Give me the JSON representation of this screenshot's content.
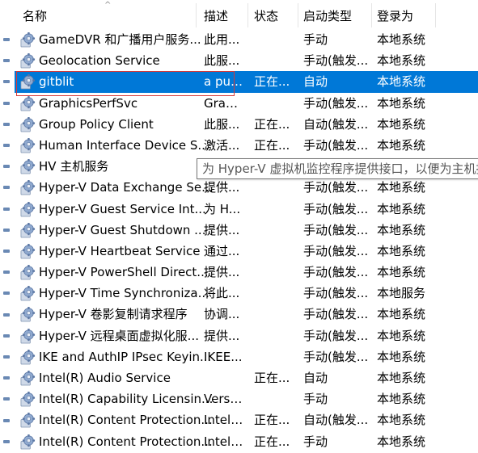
{
  "header": {
    "name": "名称",
    "description": "描述",
    "status": "状态",
    "startup_type": "启动类型",
    "logon_as": "登录为"
  },
  "colors": {
    "selection": "#0078d7",
    "highlight_border": "#d43a3a",
    "icon_gear": "#7a9cc6"
  },
  "tooltip": "为 Hyper-V 虚拟机监控程序提供接口，以便为主机提",
  "rows": [
    {
      "name": "GameDVR 和广播用户服务...",
      "desc": "此用...",
      "status": "",
      "start": "手动",
      "logon": "本地系统"
    },
    {
      "name": "Geolocation Service",
      "desc": "此服...",
      "status": "",
      "start": "手动(触发...",
      "logon": "本地系统"
    },
    {
      "name": "gitblit",
      "desc": "a pur...",
      "status": "正在...",
      "start": "自动",
      "logon": "本地系统"
    },
    {
      "name": "GraphicsPerfSvc",
      "desc": "Grap...",
      "status": "",
      "start": "手动(触发...",
      "logon": "本地系统"
    },
    {
      "name": "Group Policy Client",
      "desc": "此服...",
      "status": "正在...",
      "start": "自动(触发...",
      "logon": "本地系统"
    },
    {
      "name": "Human Interface Device S...",
      "desc": "激活...",
      "status": "正在...",
      "start": "手动(触发...",
      "logon": "本地系统"
    },
    {
      "name": "HV 主机服务",
      "desc": "",
      "status": "",
      "start": "",
      "logon": ""
    },
    {
      "name": "Hyper-V Data Exchange Se...",
      "desc": "提供...",
      "status": "",
      "start": "手动(触发...",
      "logon": "本地系统"
    },
    {
      "name": "Hyper-V Guest Service Int...",
      "desc": "为 H...",
      "status": "",
      "start": "手动(触发...",
      "logon": "本地系统"
    },
    {
      "name": "Hyper-V Guest Shutdown ...",
      "desc": "提供...",
      "status": "",
      "start": "手动(触发...",
      "logon": "本地系统"
    },
    {
      "name": "Hyper-V Heartbeat Service",
      "desc": "通过...",
      "status": "",
      "start": "手动(触发...",
      "logon": "本地系统"
    },
    {
      "name": "Hyper-V PowerShell Direct...",
      "desc": "提供...",
      "status": "",
      "start": "手动(触发...",
      "logon": "本地系统"
    },
    {
      "name": "Hyper-V Time Synchroniza...",
      "desc": "将此...",
      "status": "",
      "start": "手动(触发...",
      "logon": "本地服务"
    },
    {
      "name": "Hyper-V 卷影复制请求程序",
      "desc": "协调...",
      "status": "",
      "start": "手动(触发...",
      "logon": "本地系统"
    },
    {
      "name": "Hyper-V 远程桌面虚拟化服...",
      "desc": "提供...",
      "status": "",
      "start": "手动(触发...",
      "logon": "本地系统"
    },
    {
      "name": "IKE and AuthIP IPsec Keyin...",
      "desc": "IKEE...",
      "status": "",
      "start": "手动(触发...",
      "logon": "本地系统"
    },
    {
      "name": "Intel(R) Audio Service",
      "desc": "",
      "status": "正在...",
      "start": "自动",
      "logon": "本地系统"
    },
    {
      "name": "Intel(R) Capability Licensin...",
      "desc": "Versi...",
      "status": "",
      "start": "手动",
      "logon": "本地系统"
    },
    {
      "name": "Intel(R) Content Protection...",
      "desc": "Intel(...",
      "status": "正在...",
      "start": "自动(触发...",
      "logon": "本地系统"
    },
    {
      "name": "Intel(R) Content Protection...",
      "desc": "Intel(...",
      "status": "正在...",
      "start": "手动",
      "logon": "本地系统"
    }
  ],
  "selected_index": 2
}
